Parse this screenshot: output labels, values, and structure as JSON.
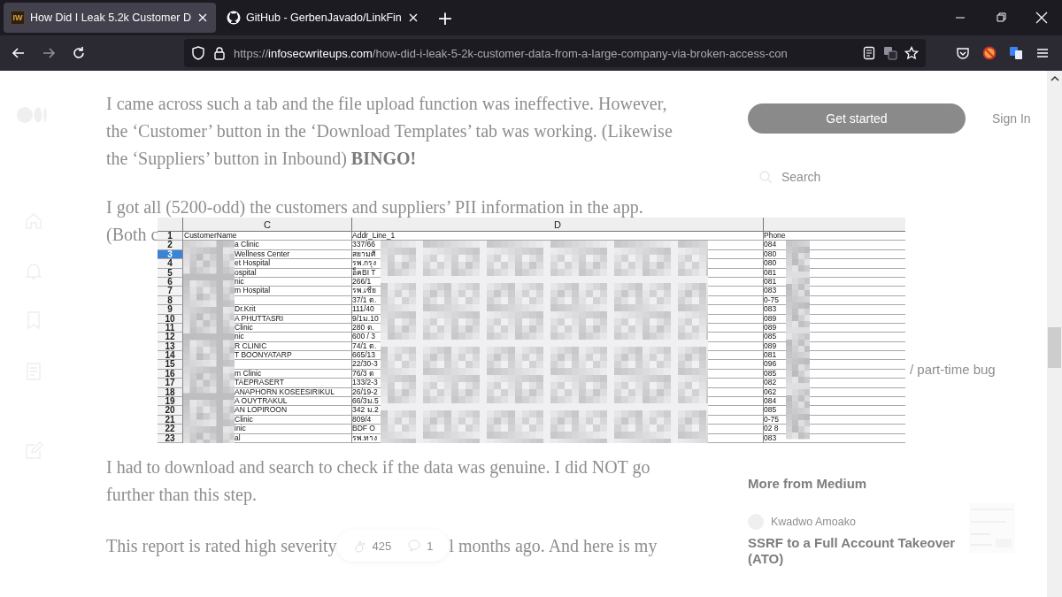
{
  "tabs": [
    {
      "title": "How Did I Leak 5.2k Customer D",
      "favicon": "IW",
      "selected": true
    },
    {
      "title": "GitHub - GerbenJavado/LinkFin",
      "selected": false
    }
  ],
  "new_tab": "+",
  "nav": [
    {
      "kind": "back",
      "disabled": false
    },
    {
      "kind": "forward",
      "disabled": true
    },
    {
      "kind": "reload",
      "disabled": false
    }
  ],
  "url": "https://**infosecwriteups.com**/how-did-i-leak-5-2k-customer-data-from-a-large-company-via-broken-access-con",
  "article": {
    "p1": "I came across such a tab and the file upload function was ineffective. However, the ‘Customer’ button in the ‘Download Templates’ tab was working. (Likewise the ‘Suppliers’ button in Inbound) **BINGO!**",
    "p2_line": "I got all (5200-odd) the customers and suppliers’ PII information in the app.",
    "p2_rest": "(Both c",
    "p3": "I had to download and search to check if the data was genuine. I did NOT go further than this step.",
    "p4_start": "This report is rated high severity",
    "claps": "425",
    "comments": "1",
    "p4_end": "l months ago. And here is my"
  },
  "sidebar": {
    "get_started": "Get started",
    "sign_in": "Sign In",
    "search_placeholder": "Search",
    "snippet": "/ part-time bug",
    "more_heading": "More from Medium",
    "author": "Kwadwo Amoako",
    "story_title": "SSRF to a Full Account Takeover (ATO)"
  },
  "spreadsheet": {
    "column_headers": [
      "C",
      "D"
    ],
    "rows": [
      {
        "num": "1",
        "name": "CustomerName",
        "addr": "Addr_Line_1",
        "phone": "Phone",
        "selected": false
      },
      {
        "num": "2",
        "name": "a Clinic",
        "addr": "337/66",
        "phone": "084",
        "selected": false
      },
      {
        "num": "3",
        "name": "Wellness Center",
        "addr": "สยามศั",
        "phone": "080",
        "selected": true
      },
      {
        "num": "4",
        "name": "et Hospital",
        "addr": "รพ.กรุง",
        "phone": "080",
        "selected": false
      },
      {
        "num": "5",
        "name": "ospital",
        "addr": "อ็คBI T",
        "phone": "081",
        "selected": false
      },
      {
        "num": "6",
        "name": "nic",
        "addr": "266/1",
        "phone": "081",
        "selected": false
      },
      {
        "num": "7",
        "name": "m Hospital",
        "addr": "รพ.เชีย",
        "phone": "083",
        "selected": false
      },
      {
        "num": "8",
        "name": "",
        "addr": "37/1 ต.",
        "phone": "0-75",
        "selected": false
      },
      {
        "num": "9",
        "name": "Dr.Krit",
        "addr": "111/40",
        "phone": "083",
        "selected": false
      },
      {
        "num": "10",
        "name": "A  PHUTTASRI",
        "addr": "9/1ม.10",
        "phone": "089",
        "selected": false
      },
      {
        "num": "11",
        "name": "Clinic",
        "addr": "280 ต.",
        "phone": "089",
        "selected": false
      },
      {
        "num": "12",
        "name": "nic",
        "addr": "600 / 3",
        "phone": "085",
        "selected": false
      },
      {
        "num": "13",
        "name": "R CLINIC",
        "addr": "74/1 ต.",
        "phone": "089",
        "selected": false
      },
      {
        "num": "14",
        "name": "T BOONYATARP",
        "addr": "665/13",
        "phone": "081",
        "selected": false
      },
      {
        "num": "15",
        "name": "",
        "addr": "22/30-3",
        "phone": "096",
        "selected": false
      },
      {
        "num": "16",
        "name": "m Clinic",
        "addr": "76/3 ต",
        "phone": "085",
        "selected": false
      },
      {
        "num": "17",
        "name": "TAEPRASERT",
        "addr": "133/2-3",
        "phone": "082",
        "selected": false
      },
      {
        "num": "18",
        "name": "ANAPHORN KOSEESIRIKUL",
        "addr": "26/19-2",
        "phone": "062",
        "selected": false
      },
      {
        "num": "19",
        "name": "A  OUYTRAKUL",
        "addr": "66/3ม.5",
        "phone": "084",
        "selected": false
      },
      {
        "num": "20",
        "name": "AN LOPIROON",
        "addr": "342 ม.2",
        "phone": "085",
        "selected": false
      },
      {
        "num": "21",
        "name": "Clinic",
        "addr": "809/4",
        "phone": "0-75",
        "selected": false
      },
      {
        "num": "22",
        "name": "inic",
        "addr": "BDF O",
        "phone": "02 8",
        "selected": false
      },
      {
        "num": "23",
        "name": "al",
        "addr": "รพ.ทาง",
        "phone": "083",
        "selected": false
      }
    ]
  }
}
